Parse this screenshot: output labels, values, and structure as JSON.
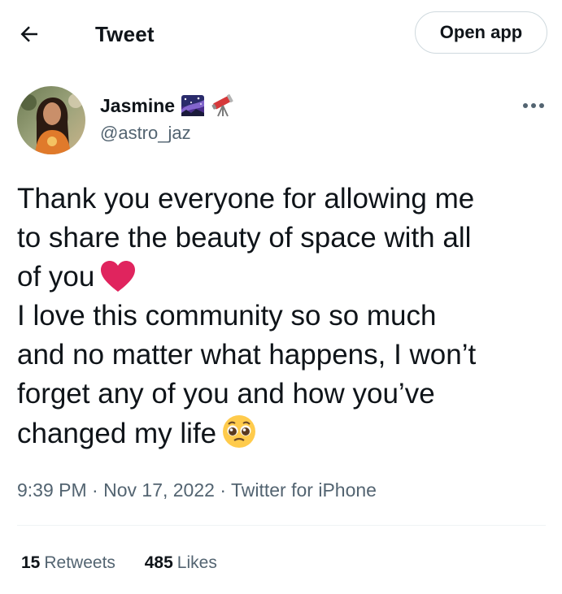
{
  "header": {
    "title": "Tweet",
    "open_app_label": "Open app",
    "back_icon": "arrow-left-icon"
  },
  "author": {
    "name": "Jasmine",
    "handle": "@astro_jaz",
    "emojis": [
      "milky-way-icon",
      "telescope-icon"
    ]
  },
  "tweet": {
    "lines": [
      "Thank you everyone for allowing me",
      "to share the beauty of space with all",
      "of you",
      "I love this community so so much",
      "and no matter what happens, I won’t",
      "forget any of you and how you’ve",
      "changed my life"
    ],
    "heart_emoji": "red-heart-icon",
    "pleading_emoji": "pleading-face-icon"
  },
  "meta": {
    "time": "9:39 PM",
    "date": "Nov 17, 2022",
    "source": "Twitter for iPhone",
    "separator": "·"
  },
  "stats": {
    "retweets_count": "15",
    "retweets_label": "Retweets",
    "likes_count": "485",
    "likes_label": "Likes"
  },
  "colors": {
    "text": "#0f1419",
    "secondary": "#536471",
    "border": "#cfd9de",
    "heart": "#e0245e"
  }
}
